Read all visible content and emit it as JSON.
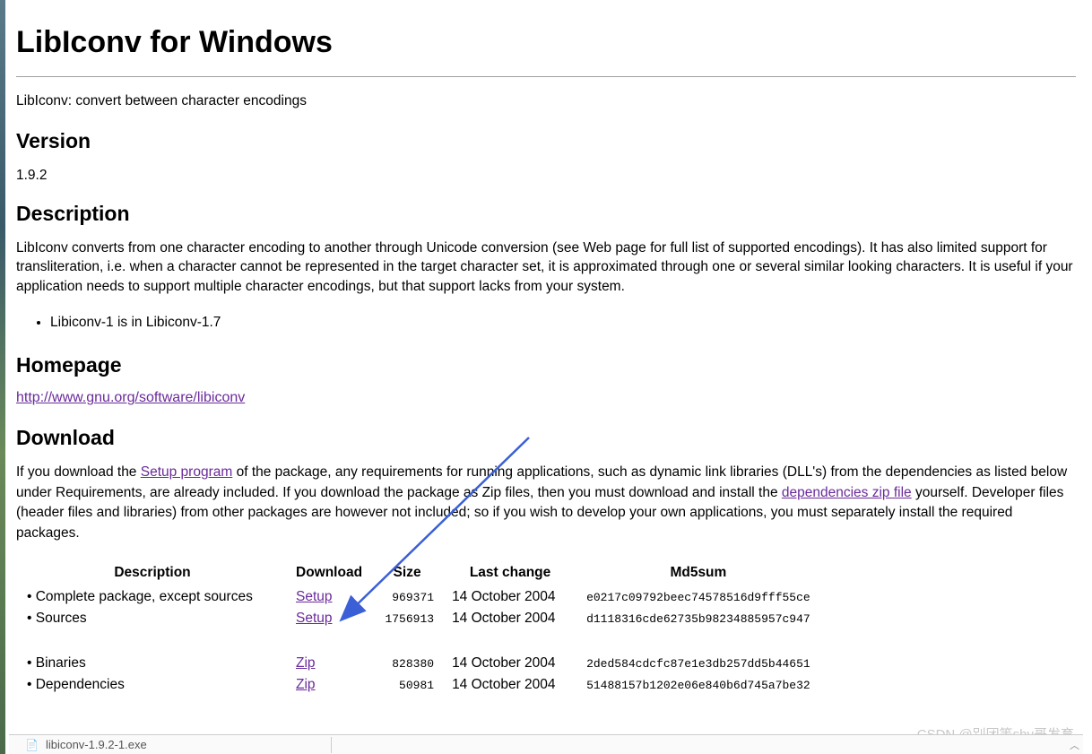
{
  "title": "LibIconv for Windows",
  "intro": "LibIconv: convert between character encodings",
  "version": {
    "heading": "Version",
    "value": "1.9.2"
  },
  "description": {
    "heading": "Description",
    "text": "LibIconv converts from one character encoding to another through Unicode conversion (see Web page for full list of supported encodings). It has also limited support for transliteration, i.e. when a character cannot be represented in the target character set, it is approximated through one or several similar looking characters. It is useful if your application needs to support multiple character encodings, but that support lacks from your system.",
    "list_item": "Libiconv-1 is in Libiconv-1.7"
  },
  "homepage": {
    "heading": "Homepage",
    "url": "http://www.gnu.org/software/libiconv"
  },
  "download": {
    "heading": "Download",
    "para_pre": "If you download the ",
    "setup_link": "Setup program",
    "para_mid": " of the package, any requirements for running applications, such as dynamic link libraries (DLL's) from the dependencies as listed below under Requirements, are already included. If you download the package as Zip files, then you must download and install the ",
    "deps_link": "dependencies zip file",
    "para_end": " yourself. Developer files (header files and libraries) from other packages are however not included; so if you wish to develop your own applications, you must separately install the required packages."
  },
  "table": {
    "headers": {
      "description": "Description",
      "download": "Download",
      "size": "Size",
      "last_change": "Last change",
      "md5sum": "Md5sum"
    },
    "rows": [
      {
        "desc": "Complete package, except sources",
        "download": "Setup",
        "size": "969371",
        "date": "14 October 2004",
        "md5": "e0217c09792beec74578516d9fff55ce"
      },
      {
        "desc": "Sources",
        "download": "Setup",
        "size": "1756913",
        "date": "14 October 2004",
        "md5": "d1118316cde62735b98234885957c947"
      },
      {
        "desc": "Binaries",
        "download": "Zip",
        "size": "828380",
        "date": "14 October 2004",
        "md5": "2ded584cdcfc87e1e3db257dd5b44651"
      },
      {
        "desc": "Dependencies",
        "download": "Zip",
        "size": "50981",
        "date": "14 October 2004",
        "md5": "51488157b1202e06e840b6d745a7be32"
      }
    ]
  },
  "watermark": "CSDN @别团等shy哥发育",
  "bottom_bar": {
    "filename": "libiconv-1.9.2-1.exe"
  }
}
